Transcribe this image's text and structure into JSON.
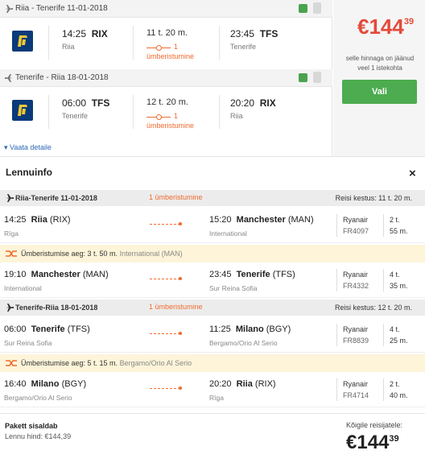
{
  "legs": [
    {
      "header": "Riia - Tenerife 11-01-2018",
      "dep_time": "14:25",
      "dep_code": "RIX",
      "dep_city": "Riia",
      "duration": "11 t. 20 m.",
      "stops_n": "1",
      "stops_label": "ümberistumine",
      "arr_time": "23:45",
      "arr_code": "TFS",
      "arr_city": "Tenerife"
    },
    {
      "header": "Tenerife - Riia 18-01-2018",
      "dep_time": "06:00",
      "dep_code": "TFS",
      "dep_city": "Tenerife",
      "duration": "12 t. 20 m.",
      "stops_n": "1",
      "stops_label": "ümberistumine",
      "arr_time": "20:20",
      "arr_code": "RIX",
      "arr_city": "Riia"
    }
  ],
  "price_panel": {
    "price_main": "€144",
    "price_cents": "39",
    "note_line1": "selle hinnaga on jäänud",
    "note_line2": "veel 1 istekohta",
    "button": "Vali"
  },
  "details_link": "Vaata detaile",
  "lennuinfo": {
    "title": "Lennuinfo",
    "close": "×",
    "segments": [
      {
        "title": "Riia-Tenerife 11-01-2018",
        "stops": "1 ümberistumine",
        "duration": "Reisi kestus: 11 t. 20 m.",
        "flights": [
          {
            "dep_time": "14:25",
            "dep_city": "Riia",
            "dep_code": "(RIX)",
            "dep_airport": "Rīga",
            "arr_time": "15:20",
            "arr_city": "Manchester",
            "arr_code": "(MAN)",
            "arr_airport": "International",
            "airline": "Ryanair",
            "flight": "FR4097",
            "dur_h": "2 t.",
            "dur_m": "55 m."
          },
          {
            "dep_time": "19:10",
            "dep_city": "Manchester",
            "dep_code": "(MAN)",
            "dep_airport": "International",
            "arr_time": "23:45",
            "arr_city": "Tenerife",
            "arr_code": "(TFS)",
            "arr_airport": "Sur Reina Sofia",
            "airline": "Ryanair",
            "flight": "FR4332",
            "dur_h": "4 t.",
            "dur_m": "35 m."
          }
        ],
        "transfer": {
          "label": "Ümberistumise aeg: 3 t. 50 m.",
          "place": "International (MAN)"
        }
      },
      {
        "title": "Tenerife-Riia 18-01-2018",
        "stops": "1 ümberistumine",
        "duration": "Reisi kestus: 12 t. 20 m.",
        "flights": [
          {
            "dep_time": "06:00",
            "dep_city": "Tenerife",
            "dep_code": "(TFS)",
            "dep_airport": "Sur Reina Sofia",
            "arr_time": "11:25",
            "arr_city": "Milano",
            "arr_code": "(BGY)",
            "arr_airport": "Bergamo/Orio Al Serio",
            "airline": "Ryanair",
            "flight": "FR8839",
            "dur_h": "4 t.",
            "dur_m": "25 m."
          },
          {
            "dep_time": "16:40",
            "dep_city": "Milano",
            "dep_code": "(BGY)",
            "dep_airport": "Bergamo/Orio Al Serio",
            "arr_time": "20:20",
            "arr_city": "Riia",
            "arr_code": "(RIX)",
            "arr_airport": "Rīga",
            "airline": "Ryanair",
            "flight": "FR4714",
            "dur_h": "2 t.",
            "dur_m": "40 m."
          }
        ],
        "transfer": {
          "label": "Ümberistumise aeg: 5 t. 15 m.",
          "place": "Bergamo/Orio Al Serio"
        }
      }
    ]
  },
  "footer": {
    "package_title": "Pakett sisaldab",
    "package_price": "Lennu hind: €144,39",
    "all_passengers": "Kõigile reisijatele:",
    "total_main": "€144",
    "total_cents": "39"
  },
  "colors": {
    "accent_red": "#e44a3a",
    "button_green": "#4cac4f",
    "stop_orange": "#f06b2f",
    "link_blue": "#2a6bb5"
  }
}
